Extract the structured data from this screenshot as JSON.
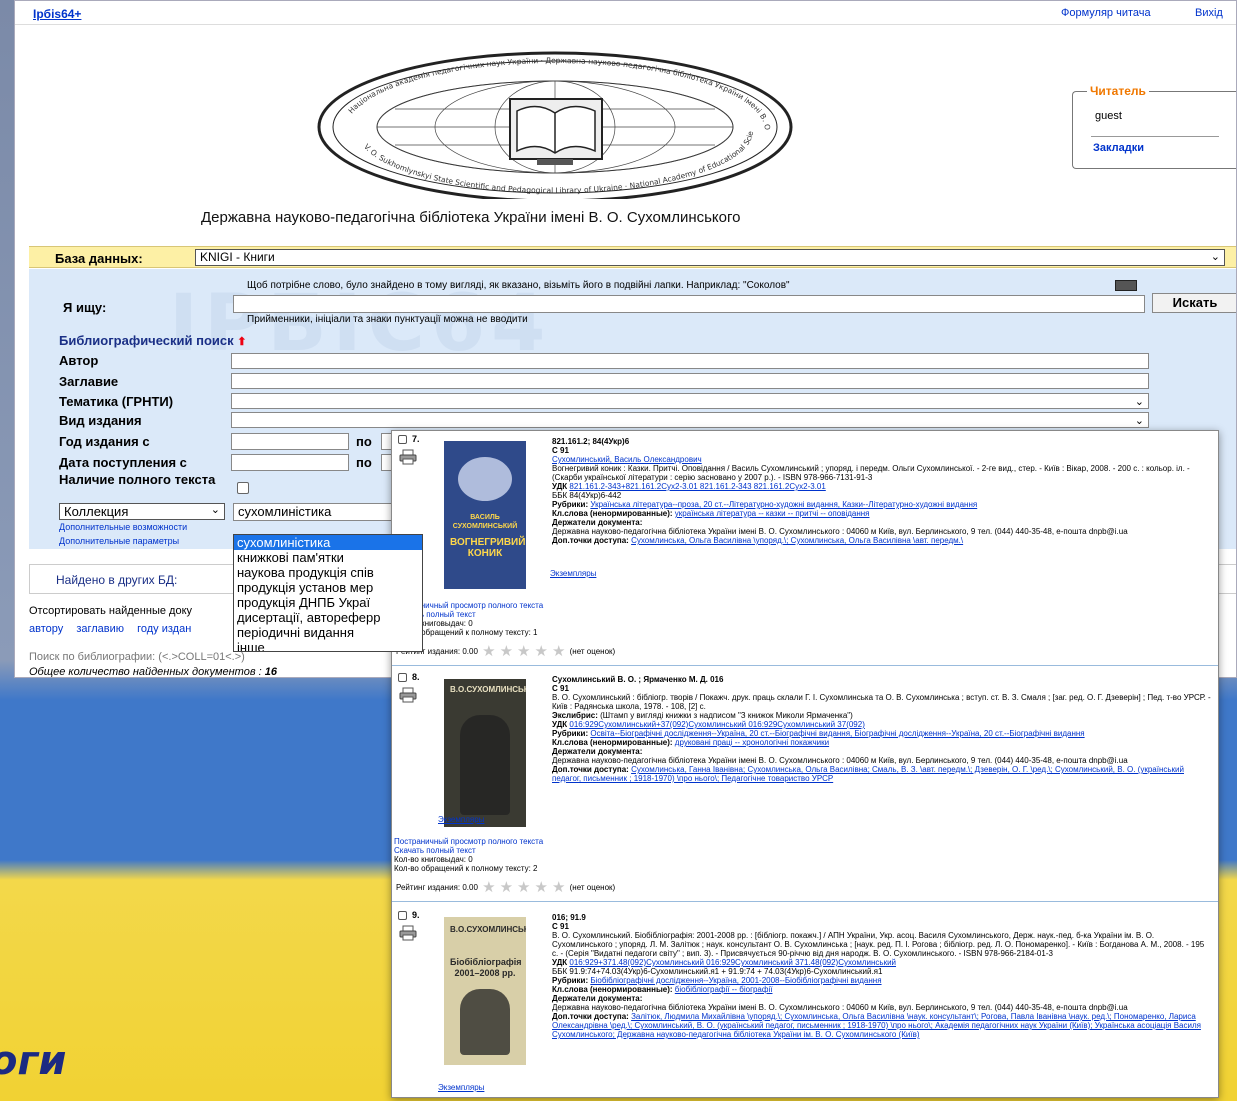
{
  "topbar": {
    "brand": "Ірбіs64+",
    "form_link": "Формуляр читача",
    "exit_link": "Вихід"
  },
  "logo": {
    "ring_top": "Національна академія педагогічних наук України · Державна науково-педагогічна бібліотека України імені В. О. Сухомлинського",
    "ring_bottom": "V. O. Sukhomlynskyi State Scientific and Pedagogical Library of Ukraine · National Academy of Educational Sciences of Ukraine"
  },
  "library_name": "Державна науково-педагогічна бібліотека України імені В. О. Сухомлинського",
  "reader": {
    "legend": "Читатель",
    "user": "guest",
    "bookmarks": "Закладки"
  },
  "database": {
    "label": "База данных:",
    "value": "KNIGI - Книги"
  },
  "search": {
    "hint_top": "Щоб потрібне слово, було знайдено в тому вигляді, як вказано, візьміть його в подвійні лапки. Наприклад: \"Соколов\"",
    "label": "Я ищу:",
    "query": "",
    "button": "Искать",
    "hint_bottom": "Прийменники, ініціали та знаки пунктуації можна не вводити",
    "biblio_title": "Библиографический поиск",
    "fields": {
      "author": "Автор",
      "title": "Заглавие",
      "topic": "Тематика (ГРНТИ)",
      "edition_type": "Вид издания",
      "year_from": "Год издания с",
      "date_from": "Дата поступления с",
      "to": "по",
      "full_text": "Наличие полного текста"
    },
    "collection": {
      "select": "Коллекция",
      "value": "сухомлиністика"
    },
    "adv_options": "Дополнительные возможности",
    "adv_params": "Дополнительные параметры",
    "dropdown": [
      "сухомлиністика",
      "книжкові пам'ятки",
      "наукова продукція спів",
      "продукція установ мер",
      "продукція ДНПБ Украї",
      "дисертації, автореферр",
      "періодичні видання",
      "інше"
    ]
  },
  "found_other": "Найдено в других БД:",
  "sort": {
    "label": "Отсортировать найденные доку",
    "by": [
      "автору",
      "заглавию",
      "году издан"
    ]
  },
  "query_line": "Поиск по библиографии: (<.>COLL=01<.>)",
  "total": {
    "label": "Общее количество найденных документов",
    "sep": " : ",
    "value": "16"
  },
  "records": [
    {
      "num": "7.",
      "cover_title": "ВАСИЛЬ СУХОМЛИНСЬКИЙ",
      "cover_subtitle": "ВОГНЕГРИВИЙ КОНИК",
      "lines": [
        {
          "b": "821.161.2; 84(4Укр)6"
        },
        {
          "b": "С 91"
        },
        {
          "a": "Сухомлинський, Василь Олександрович"
        },
        {
          "t": "   Вогнегривий коник : Казки. Притчі. Оповідання / Василь Сухомлинський ; упоряд. і передм. Ольги Сухомлинської. - 2-ге вид., стер. - Київ : Вікар, 2008. - 200 с. : кольор. іл. - (Скарби української літератури : серію засновано у 2007 р.). - ISBN 978-966-7131-91-3"
        },
        {
          "k": "УДК ",
          "a": "821.161.2-343+821.161.2Сух2-3.01  821.161.2-343  821.161.2Сух2-3.01"
        },
        {
          "t": "ББК 84(4Укр)6-442"
        },
        {
          "k": "Рубрики: ",
          "a": "Українська література--проза, 20 ст.--Літературно-художні видання, Казки--Літературно-художні видання"
        },
        {
          "k": "Кл.слова (ненормированные): ",
          "a": "українська література -- казки -- притчі -- оповідання"
        },
        {
          "b": "Держатели документа:"
        },
        {
          "t": "Державна науково-педагогічна бібліотека України імені В. О. Сухомлинського : 04060 м Київ, вул. Берлинського, 9 тел. (044) 440-35-48, е-пошта dnpb@i.ua"
        },
        {
          "k": "Доп.точки доступа: ",
          "a": "Сухомлинська, Ольга Василівна \\упоряд.\\; Сухомлинська, Ольга Василівна \\авт. передм.\\"
        }
      ],
      "copies": "Экземпляры",
      "view": "Постраничный просмотр полного текста",
      "download": "Скачать полный текст",
      "loans": "Кол-во книговыдач: 0",
      "access": "Кол-во обращений к полному тексту: 1",
      "rating": "Рейтинг издания: 0.00",
      "no_ratings": "(нет оценок)"
    },
    {
      "num": "8.",
      "cover_title": "В.О.СУХОМЛИНСЬКИЙ",
      "cover_subtitle": "",
      "lines": [
        {
          "b": "Сухомлинський В. О. ; Ярмаченко М. Д. 016"
        },
        {
          "b": "С 91"
        },
        {
          "t": ""
        },
        {
          "t": "   В. О. Сухомлинський : бібліогр. творів / Покажч. друк. праць склали Г. І. Сухомлинська та О. В. Сухомлинська ; вступ. ст. В. З. Смаля ; [заг. ред. О. Г. Дзеверін] ; Пед. т-во УРСР. - Київ : Радянська школа, 1978. - 108, [2] с."
        },
        {
          "k": "Экслибрис: ",
          "t": "(Штамп у вигляді книжки з надписом \"З книжок Миколи Ярмаченка\")"
        },
        {
          "k": "УДК ",
          "a": "016:929Сухомлинський+37(092)Сухомлинський  016:929Сухомлинський  37(092)"
        },
        {
          "k": "Рубрики: ",
          "a": "Освіта--Біографічні дослідження--Україна, 20 ст.--Біографічні видання, Біографічні дослідження--Україна, 20 ст.--Біографічні видання"
        },
        {
          "k": "Кл.слова (ненормированные): ",
          "a": "друковані праці -- хронологічні покажчики"
        },
        {
          "b": "Держатели документа:"
        },
        {
          "t": "Державна науково-педагогічна бібліотека України імені В. О. Сухомлинського : 04060 м Київ, вул. Берлинського, 9 тел. (044) 440-35-48, е-пошта dnpb@i.ua"
        },
        {
          "k": "Доп.точки доступа: ",
          "a": "Сухомлинська, Ганна Іванівна; Сухомлинська, Ольга Василівна; Смаль, В. З. \\авт. передм.\\; Дзеверін, О. Г. \\ред.\\; Сухомлинський, В. О. (український педагог, письменник ; 1918-1970) \\про нього\\; Педагогічне товариство УРСР"
        }
      ],
      "copies": "Экземпляры",
      "view": "Постраничный просмотр полного текста",
      "download": "Скачать полный текст",
      "loans": "Кол-во книговыдач: 0",
      "access": "Кол-во обращений к полному тексту: 2",
      "rating": "Рейтинг издания: 0.00",
      "no_ratings": "(нет оценок)"
    },
    {
      "num": "9.",
      "cover_title": "В.О.СУХОМЛИНСЬКИЙ",
      "cover_subtitle": "Біобібліографія 2001–2008 рр.",
      "lines": [
        {
          "b": "016; 91.9"
        },
        {
          "b": "С 91"
        },
        {
          "t": ""
        },
        {
          "t": "   В. О. Сухомлинський. Біобібліографія: 2001-2008 рр. : [бібліогр. покажч.] / АПН України, Укр. асоц. Василя Сухомлинського, Держ. наук.-пед. б-ка України ім. В. О. Сухомлинського ; упоряд. Л. М. Залітюк ; наук. консультант О. В. Сухомлинська ; [наук. ред. П. І. Рогова ; бібліогр. ред. Л. О. Пономаренко]. - Київ : Богданова А. М., 2008. - 195 с. - (Серія \"Видатні педагоги світу\" ; вип. 3). - Присвячується 90-річчю від дня народж. В. О. Сухомлинського. - ISBN 978-966-2184-01-3"
        },
        {
          "k": "УДК ",
          "a": "016:929+371.48(092)Сухомлинський  016:929Сухомлинський  371.48(092)Сухомлинський"
        },
        {
          "t": "ББК 91.9:74+74.03(4Укр)6-Сухомлинський.я1 + 91.9:74 + 74.03(4Укр)6-Сухомлинський.я1"
        },
        {
          "k": "Рубрики: ",
          "a": "Біобібліографічні дослідження--Україна, 2001-2008--Біобібліографічні видання"
        },
        {
          "k": "Кл.слова (ненормированные): ",
          "a": "біобібліографії -- біографії"
        },
        {
          "b": "Держатели документа:"
        },
        {
          "t": "Державна науково-педагогічна бібліотека України імені В. О. Сухомлинського : 04060 м Київ, вул. Берлинського, 9 тел. (044) 440-35-48, е-пошта dnpb@i.ua"
        },
        {
          "k": "Доп.точки доступа: ",
          "a": "Залітюк, Людмила Михайлівна \\упоряд.\\; Сухомлинська, Ольга Василівна \\наук. консультант\\; Рогова, Павла Іванівна \\наук. ред.\\; Пономаренко, Лариса Олександрівна \\ред.\\; Сухомлинський, В. О. (український педагог, письменник ; 1918-1970) \\про нього\\; Академія педагогічних наук України (Київ); Українська асоціація Василя Сухомлинського; Державна науково-педагогічна бібліотека України ім. В. О. Сухомлинського (Київ)"
        }
      ],
      "copies": "Экземпляры"
    }
  ],
  "background_text": "оги",
  "colors": {
    "accent": "#0033cc",
    "db_bar": "#fdf0a5",
    "search_bg": "#dbe9f9",
    "reader_legend": "#f07800",
    "dropdown_selected": "#1a73e8"
  }
}
